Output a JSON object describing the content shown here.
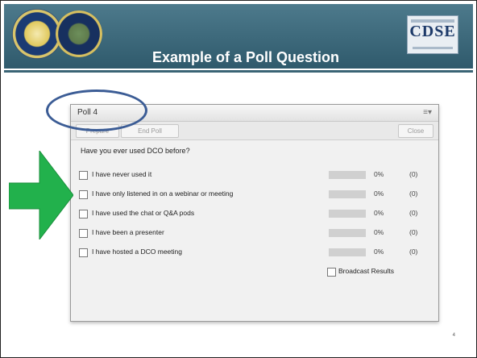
{
  "slide": {
    "title": "Example of a Poll Question",
    "logo_text": "CDSE",
    "page_number": "4"
  },
  "poll": {
    "window_title": "Poll 4",
    "menu_icon": "≡▾",
    "buttons": {
      "prepare": "Prepare",
      "end_poll": "End Poll",
      "close": "Close"
    },
    "question": "Have you ever used DCO before?",
    "options": [
      {
        "label": "I have never used it",
        "percent": "0%",
        "count": "(0)",
        "fill": 0
      },
      {
        "label": "I have only listened in on a webinar or meeting",
        "percent": "0%",
        "count": "(0)",
        "fill": 0
      },
      {
        "label": "I have used the chat or Q&A pods",
        "percent": "0%",
        "count": "(0)",
        "fill": 0
      },
      {
        "label": "I have been a presenter",
        "percent": "0%",
        "count": "(0)",
        "fill": 0
      },
      {
        "label": "I have hosted a DCO meeting",
        "percent": "0%",
        "count": "(0)",
        "fill": 0
      }
    ],
    "broadcast_label": "Broadcast Results"
  },
  "colors": {
    "header": "#3a6475",
    "callout": "#3b5c95",
    "arrow": "#22b14c"
  },
  "icons": {
    "dod_seal": "dod-seal-icon",
    "dss_seal": "dss-seal-icon",
    "arrow": "green-arrow-icon"
  }
}
